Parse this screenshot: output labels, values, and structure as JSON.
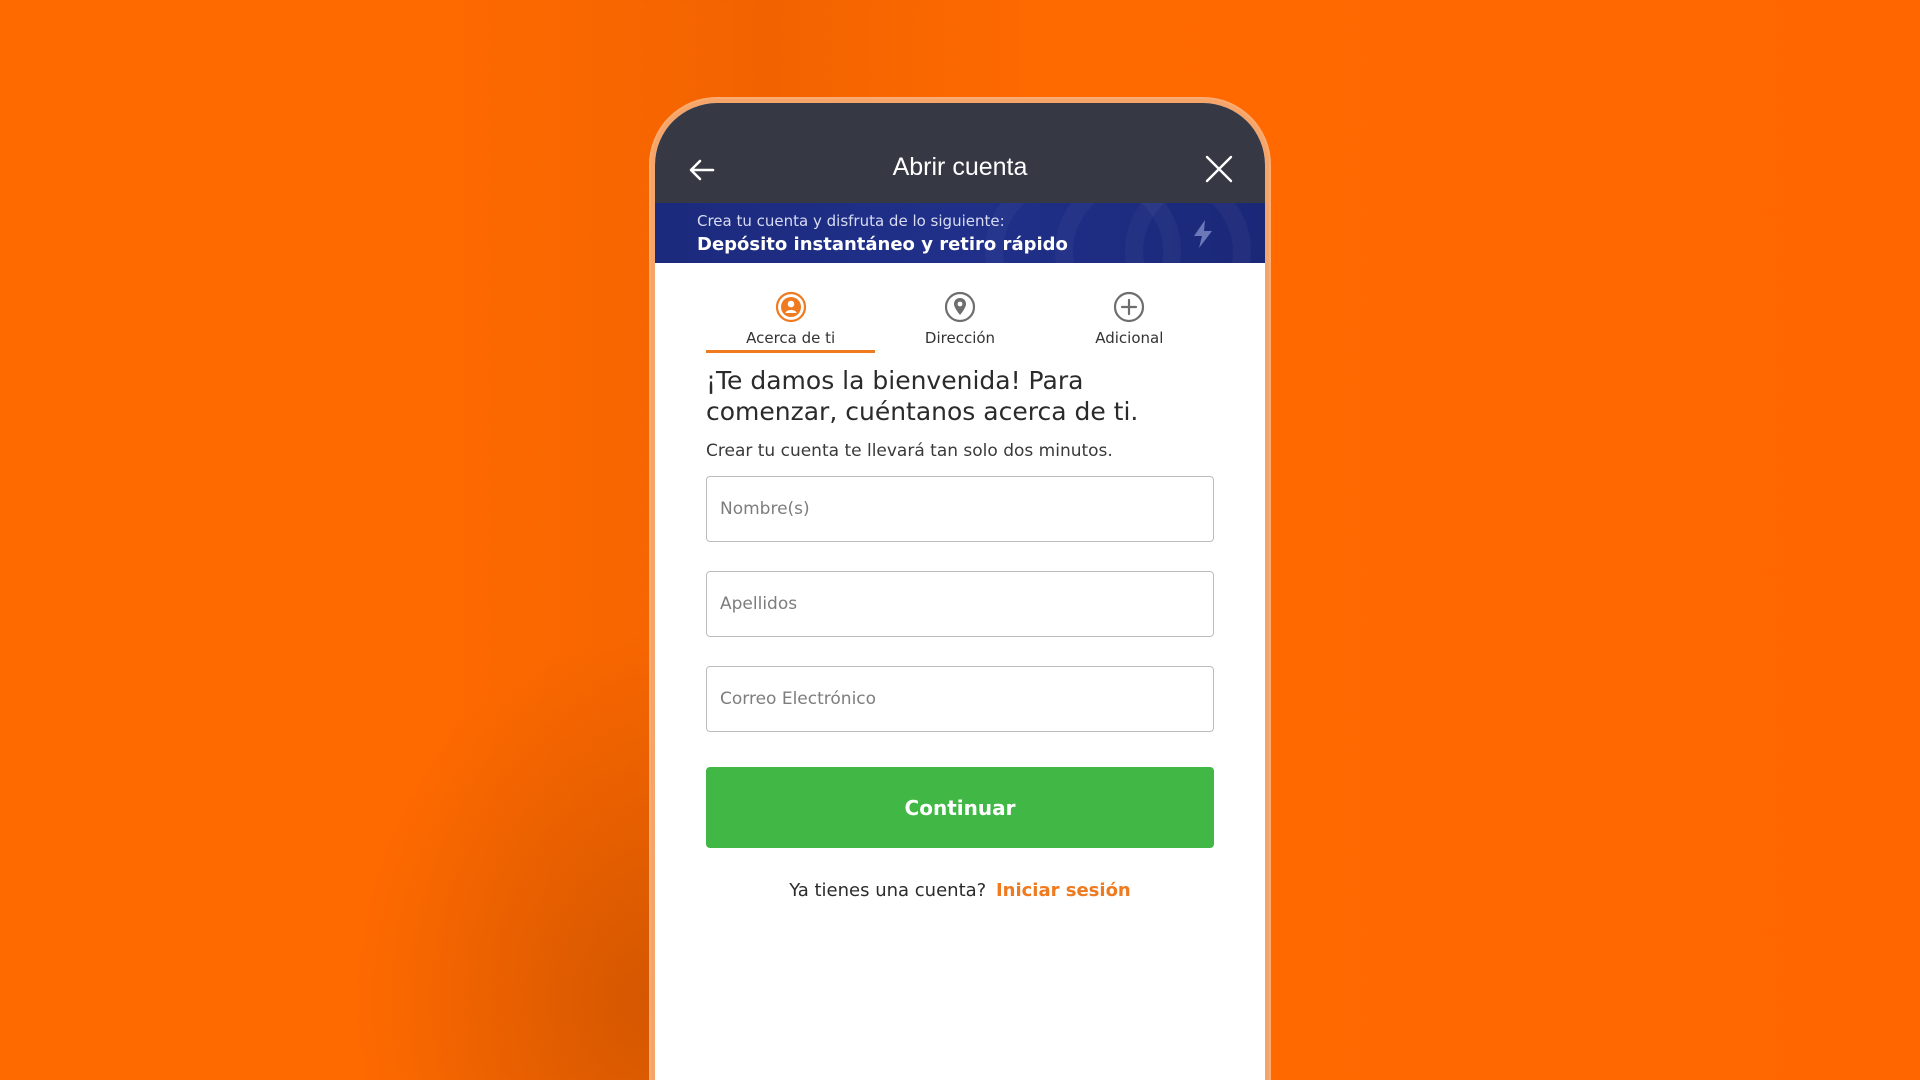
{
  "header": {
    "title": "Abrir cuenta",
    "back_icon": "arrow-left-icon",
    "close_icon": "close-icon",
    "background": "#363843"
  },
  "promo": {
    "subtitle": "Crea tu cuenta y disfruta de lo siguiente:",
    "headline": "Depósito instantáneo y retiro rápido",
    "icon": "lightning-bolt-icon",
    "background": "#1f2e86"
  },
  "steps": [
    {
      "label": "Acerca de ti",
      "icon": "user-circle-icon",
      "active": true
    },
    {
      "label": "Dirección",
      "icon": "location-pin-icon",
      "active": false
    },
    {
      "label": "Adicional",
      "icon": "plus-circle-icon",
      "active": false
    }
  ],
  "form": {
    "headline": "¡Te damos la bienvenida! Para comenzar, cuéntanos acerca de ti.",
    "subline": "Crear tu cuenta te llevará tan solo dos minutos.",
    "first_name_placeholder": "Nombre(s)",
    "last_name_placeholder": "Apellidos",
    "email_placeholder": "Correo Electrónico",
    "continue_label": "Continuar"
  },
  "login": {
    "prompt": "Ya tienes una cuenta?",
    "link_label": "Iniciar sesión"
  },
  "colors": {
    "background_orange": "#ff6a00",
    "accent_orange": "#ef7a1f",
    "button_green": "#41b846"
  }
}
